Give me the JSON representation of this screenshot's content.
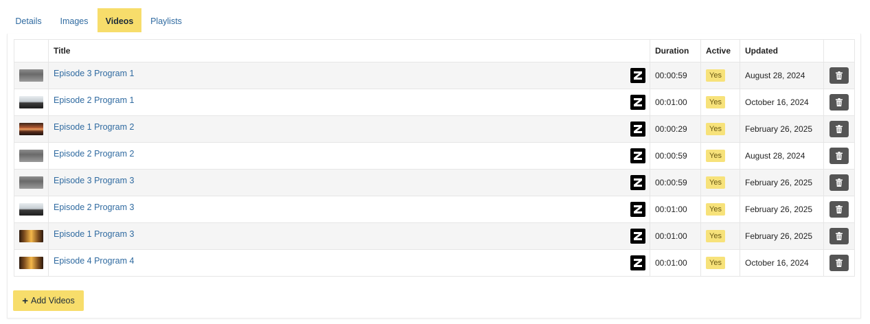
{
  "tabs": [
    {
      "label": "Details"
    },
    {
      "label": "Images"
    },
    {
      "label": "Videos"
    },
    {
      "label": "Playlists"
    }
  ],
  "table": {
    "headers": {
      "thumb": "",
      "title": "Title",
      "duration": "Duration",
      "active": "Active",
      "updated": "Updated",
      "actions": ""
    },
    "rows": [
      {
        "thumb": "gravel",
        "title": "Episode 3 Program 1",
        "duration": "00:00:59",
        "active": "Yes",
        "updated": "August 28, 2024"
      },
      {
        "thumb": "landscape",
        "title": "Episode 2 Program 1",
        "duration": "00:01:00",
        "active": "Yes",
        "updated": "October 16, 2024"
      },
      {
        "thumb": "sunset",
        "title": "Episode 1 Program 2",
        "duration": "00:00:29",
        "active": "Yes",
        "updated": "February 26, 2025"
      },
      {
        "thumb": "gravel",
        "title": "Episode 2 Program 2",
        "duration": "00:00:59",
        "active": "Yes",
        "updated": "August 28, 2024"
      },
      {
        "thumb": "gravel",
        "title": "Episode 3 Program 3",
        "duration": "00:00:59",
        "active": "Yes",
        "updated": "February 26, 2025"
      },
      {
        "thumb": "landscape",
        "title": "Episode 2 Program 3",
        "duration": "00:01:00",
        "active": "Yes",
        "updated": "February 26, 2025"
      },
      {
        "thumb": "trees",
        "title": "Episode 1 Program 3",
        "duration": "00:01:00",
        "active": "Yes",
        "updated": "February 26, 2025"
      },
      {
        "thumb": "trees",
        "title": "Episode 4 Program 4",
        "duration": "00:01:00",
        "active": "Yes",
        "updated": "October 16, 2024"
      }
    ]
  },
  "add_button": {
    "label": "Add Videos",
    "icon": "plus-icon"
  },
  "colors": {
    "accent": "#f7dd6b",
    "link": "#2f6aa0",
    "badge": "#f7e27a",
    "delete_button": "#555555"
  }
}
